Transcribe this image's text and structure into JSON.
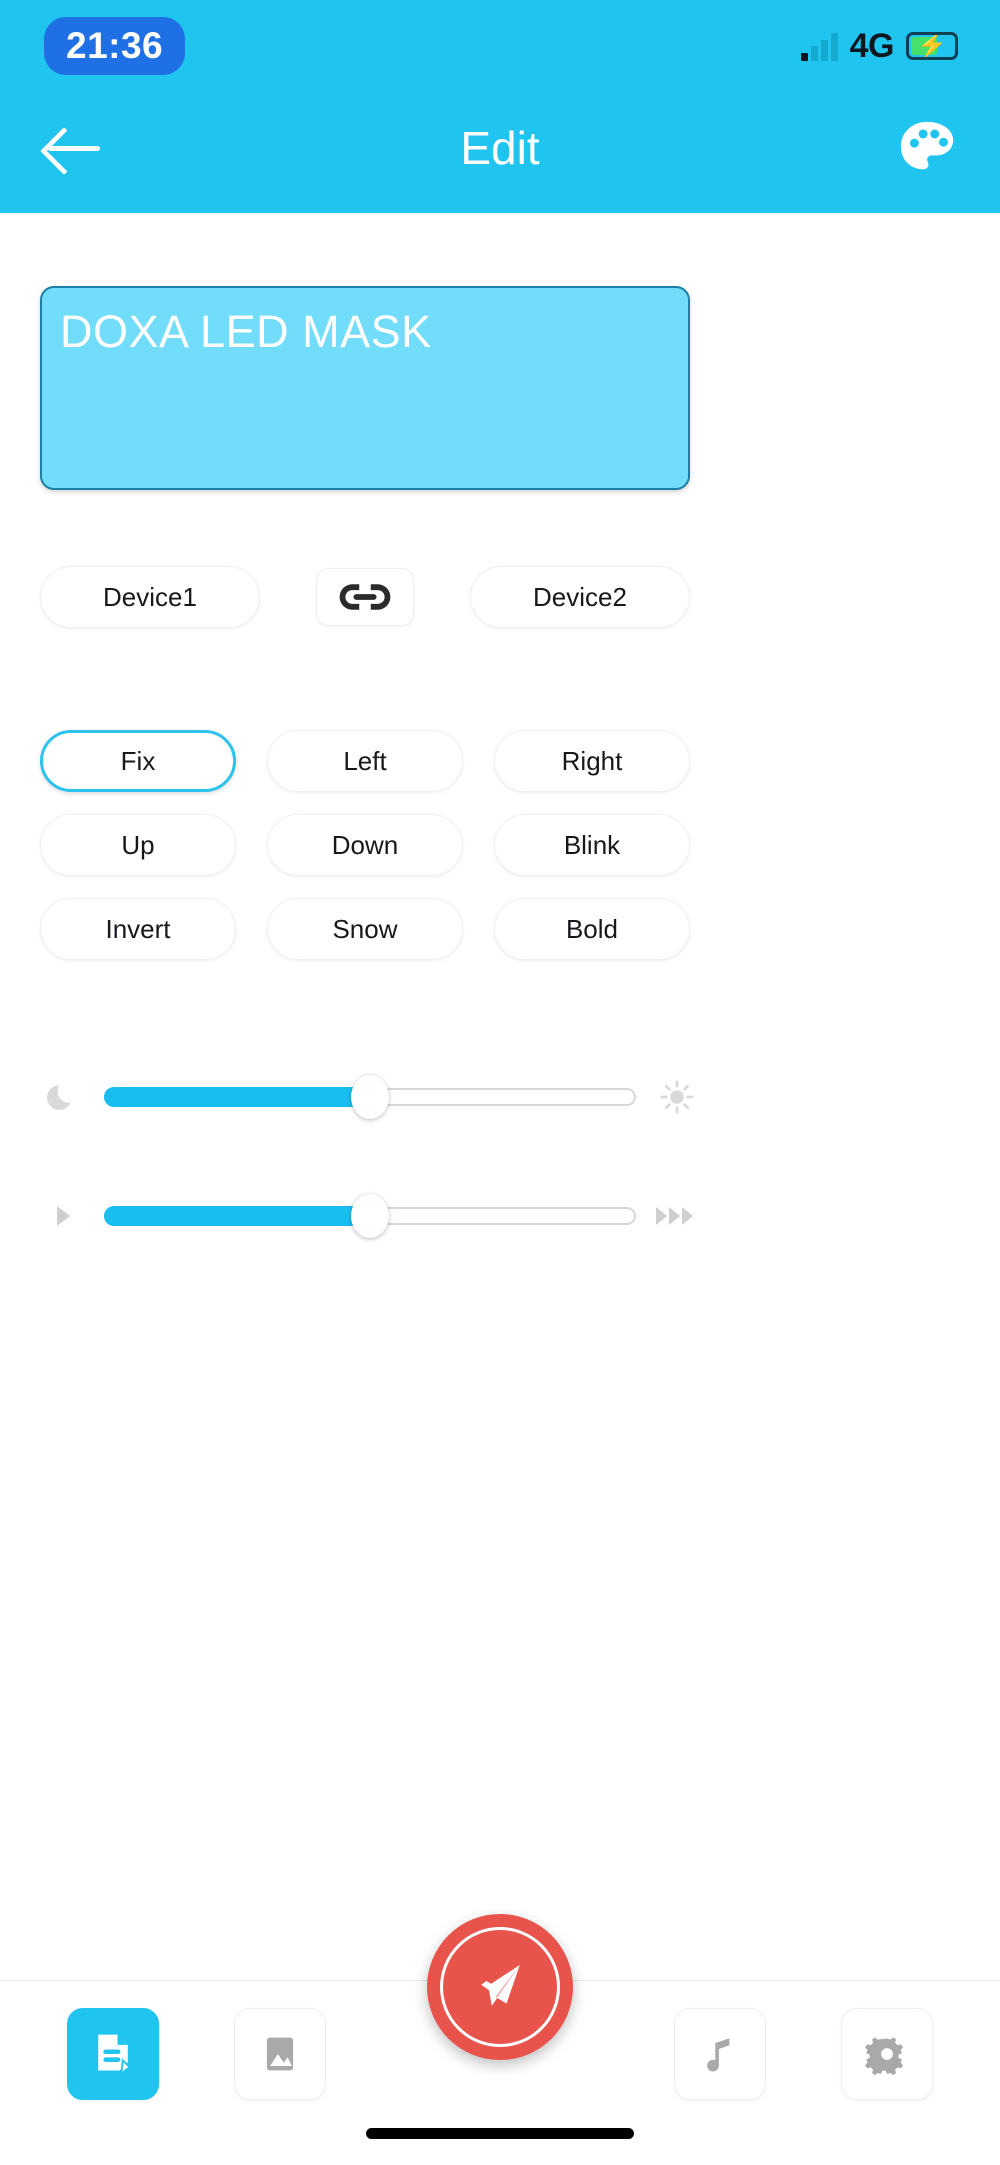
{
  "statusbar": {
    "time": "21:36",
    "network": "4G",
    "signal_icon": "signal-bars-icon",
    "battery_icon": "battery-charging-icon"
  },
  "header": {
    "title": "Edit",
    "back_icon": "back-arrow-icon",
    "palette_icon": "palette-icon",
    "background_color": "#1fc4ef"
  },
  "editor": {
    "text": "DOXA LED MASK",
    "placeholder": "",
    "background_color": "#72dcfb",
    "border_color": "#1b7fa6",
    "text_color": "#ffffff"
  },
  "devices": {
    "device1_label": "Device1",
    "link_icon": "link-chain-icon",
    "device2_label": "Device2"
  },
  "effects": {
    "selected": "Fix",
    "selected_color": "#2cc3ef",
    "items": [
      {
        "label": "Fix",
        "selected": true
      },
      {
        "label": "Left",
        "selected": false
      },
      {
        "label": "Right",
        "selected": false
      },
      {
        "label": "Up",
        "selected": false
      },
      {
        "label": "Down",
        "selected": false
      },
      {
        "label": "Blink",
        "selected": false
      },
      {
        "label": "Invert",
        "selected": false
      },
      {
        "label": "Snow",
        "selected": false
      },
      {
        "label": "Bold",
        "selected": false
      }
    ]
  },
  "sliders": {
    "fill_color": "#19bef0",
    "brightness": {
      "name": "brightness-slider",
      "value": 50,
      "min": 0,
      "max": 100,
      "left_icon": "moon-icon",
      "right_icon": "sun-icon"
    },
    "speed": {
      "name": "speed-slider",
      "value": 50,
      "min": 0,
      "max": 100,
      "left_icon": "play-triangle-icon",
      "right_icon": "fast-forward-icon"
    }
  },
  "tabbar": {
    "items": [
      {
        "icon": "text-document-edit-icon",
        "active": true
      },
      {
        "icon": "image-picture-icon",
        "active": false
      },
      {
        "icon": "music-note-icon",
        "active": false
      },
      {
        "icon": "gear-settings-icon",
        "active": false
      }
    ],
    "send_button": {
      "icon": "send-paper-plane-icon",
      "color": "#e8544b"
    },
    "active_color": "#1fc4ef"
  }
}
